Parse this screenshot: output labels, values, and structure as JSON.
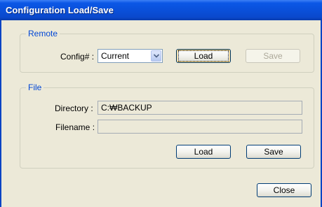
{
  "window": {
    "title": "Configuration Load/Save"
  },
  "remote": {
    "legend": "Remote",
    "config_label": "Config# :",
    "config_value": "Current",
    "load_label": "Load",
    "save_label": "Save"
  },
  "file": {
    "legend": "File",
    "directory_label": "Directory :",
    "directory_value": "C:₩BACKUP",
    "filename_label": "Filename :",
    "filename_value": "",
    "load_label": "Load",
    "save_label": "Save"
  },
  "footer": {
    "close_label": "Close"
  },
  "icons": {
    "dropdown": "chevron-down-icon"
  },
  "colors": {
    "title_bar": "#0a4fd8",
    "legend_text": "#0046d5",
    "dialog_bg": "#ece9d8"
  }
}
